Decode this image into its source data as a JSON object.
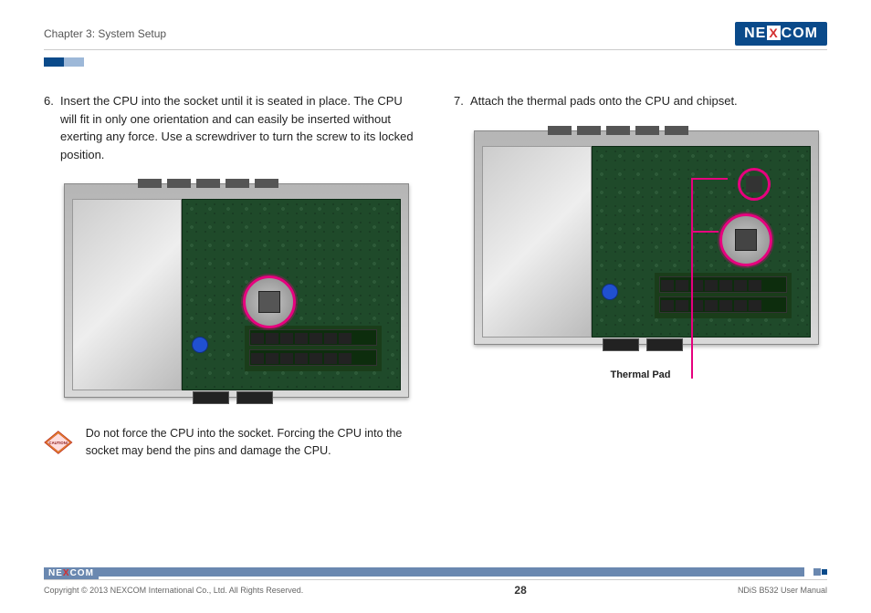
{
  "header": {
    "chapter": "Chapter 3: System Setup",
    "logo_left": "NE",
    "logo_x": "X",
    "logo_right": "COM"
  },
  "left_column": {
    "step_num": "6.",
    "step_text": "Insert the CPU into the socket until it is seated in place. The CPU will fit in only one orientation and can easily be inserted without exerting any force. Use a screwdriver to turn the screw to its locked position.",
    "caution_label": "CAUTION!",
    "caution_text": "Do not force the CPU into the socket. Forcing the CPU into the socket may bend the pins and damage the CPU."
  },
  "right_column": {
    "step_num": "7.",
    "step_text": "Attach the thermal pads onto the CPU and chipset.",
    "thermal_label": "Thermal Pad"
  },
  "footer": {
    "copyright": "Copyright © 2013 NEXCOM International Co., Ltd. All Rights Reserved.",
    "page": "28",
    "doc": "NDiS B532 User Manual"
  }
}
